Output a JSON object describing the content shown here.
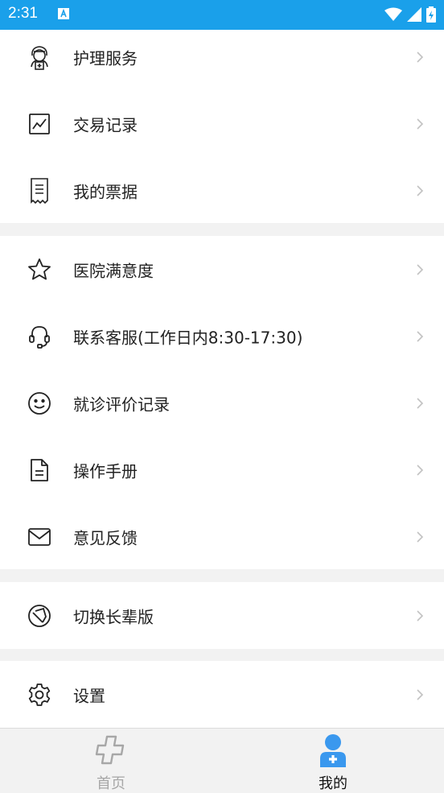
{
  "status_bar": {
    "time": "2:31"
  },
  "menu": {
    "group1": [
      {
        "label": "护理服务",
        "icon": "nurse-icon"
      },
      {
        "label": "交易记录",
        "icon": "chart-icon"
      },
      {
        "label": "我的票据",
        "icon": "receipt-icon"
      }
    ],
    "group2": [
      {
        "label": "医院满意度",
        "icon": "star-icon"
      },
      {
        "label": "联系客服(工作日内8:30-17:30)",
        "icon": "headset-icon"
      },
      {
        "label": "就诊评价记录",
        "icon": "smile-icon"
      },
      {
        "label": "操作手册",
        "icon": "document-icon"
      },
      {
        "label": "意见反馈",
        "icon": "mail-icon"
      }
    ],
    "group3": [
      {
        "label": "切换长辈版",
        "icon": "switch-icon"
      }
    ],
    "group4": [
      {
        "label": "设置",
        "icon": "gear-icon"
      }
    ]
  },
  "tabbar": {
    "home_label": "首页",
    "mine_label": "我的"
  },
  "colors": {
    "status_bar": "#1aa0ea",
    "accent": "#3a98ee",
    "inactive": "#a7a7a7"
  }
}
